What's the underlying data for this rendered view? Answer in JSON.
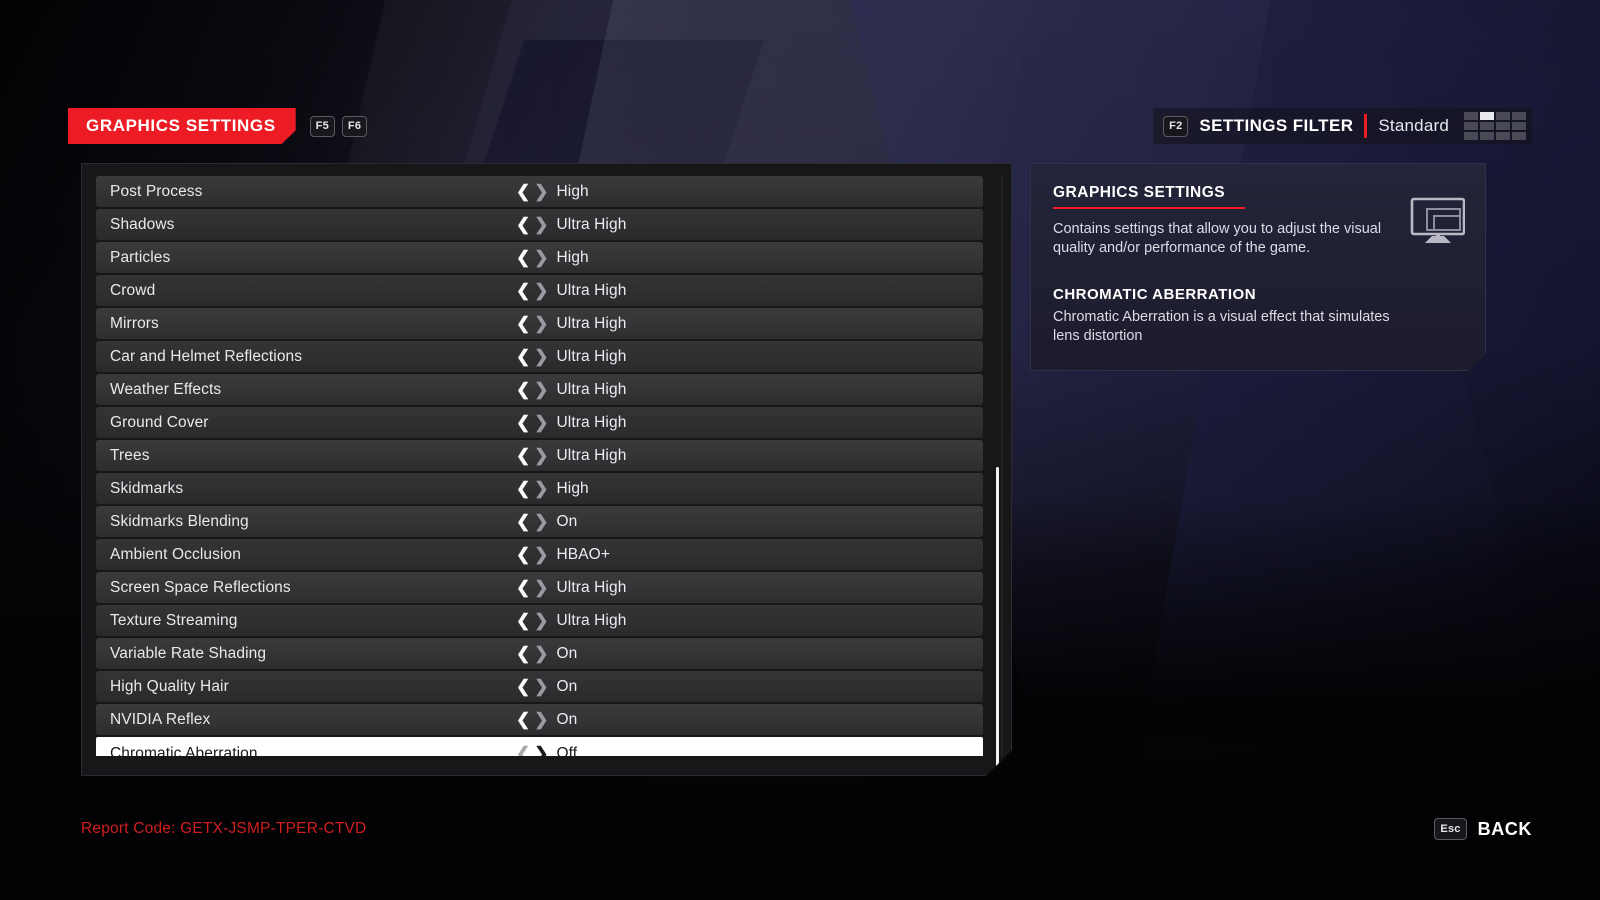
{
  "header": {
    "tab_label": "GRAPHICS SETTINGS",
    "tab_keys": [
      "F5",
      "F6"
    ],
    "filter_key": "F2",
    "filter_label": "SETTINGS FILTER",
    "filter_value": "Standard",
    "accent_color": "#ed1c24",
    "grid_icon": "settings-filter-grid-icon"
  },
  "settings": [
    {
      "label": "Post Process",
      "value": "High"
    },
    {
      "label": "Shadows",
      "value": "Ultra High"
    },
    {
      "label": "Particles",
      "value": "High"
    },
    {
      "label": "Crowd",
      "value": "Ultra High"
    },
    {
      "label": "Mirrors",
      "value": "Ultra High"
    },
    {
      "label": "Car and Helmet Reflections",
      "value": "Ultra High"
    },
    {
      "label": "Weather Effects",
      "value": "Ultra High"
    },
    {
      "label": "Ground Cover",
      "value": "Ultra High"
    },
    {
      "label": "Trees",
      "value": "Ultra High"
    },
    {
      "label": "Skidmarks",
      "value": "High"
    },
    {
      "label": "Skidmarks Blending",
      "value": "On"
    },
    {
      "label": "Ambient Occlusion",
      "value": "HBAO+"
    },
    {
      "label": "Screen Space Reflections",
      "value": "Ultra High"
    },
    {
      "label": "Texture Streaming",
      "value": "Ultra High"
    },
    {
      "label": "Variable Rate Shading",
      "value": "On"
    },
    {
      "label": "High Quality Hair",
      "value": "On"
    },
    {
      "label": "NVIDIA Reflex",
      "value": "On"
    },
    {
      "label": "Chromatic Aberration",
      "value": "Off",
      "selected": true
    }
  ],
  "arrows": {
    "left": "❮",
    "right": "❯"
  },
  "info": {
    "section_title": "GRAPHICS SETTINGS",
    "section_desc": "Contains settings that allow you to adjust the visual quality and/or performance of the game.",
    "item_title": "CHROMATIC ABERRATION",
    "item_desc": "Chromatic Aberration is a visual effect that simulates lens distortion",
    "icon": "monitor-icon",
    "rule_color": "#ed1c24"
  },
  "footer": {
    "report_code": "Report Code: GETX-JSMP-TPER-CTVD",
    "report_code_color": "#cf1e20",
    "back_key": "Esc",
    "back_label": "BACK"
  }
}
